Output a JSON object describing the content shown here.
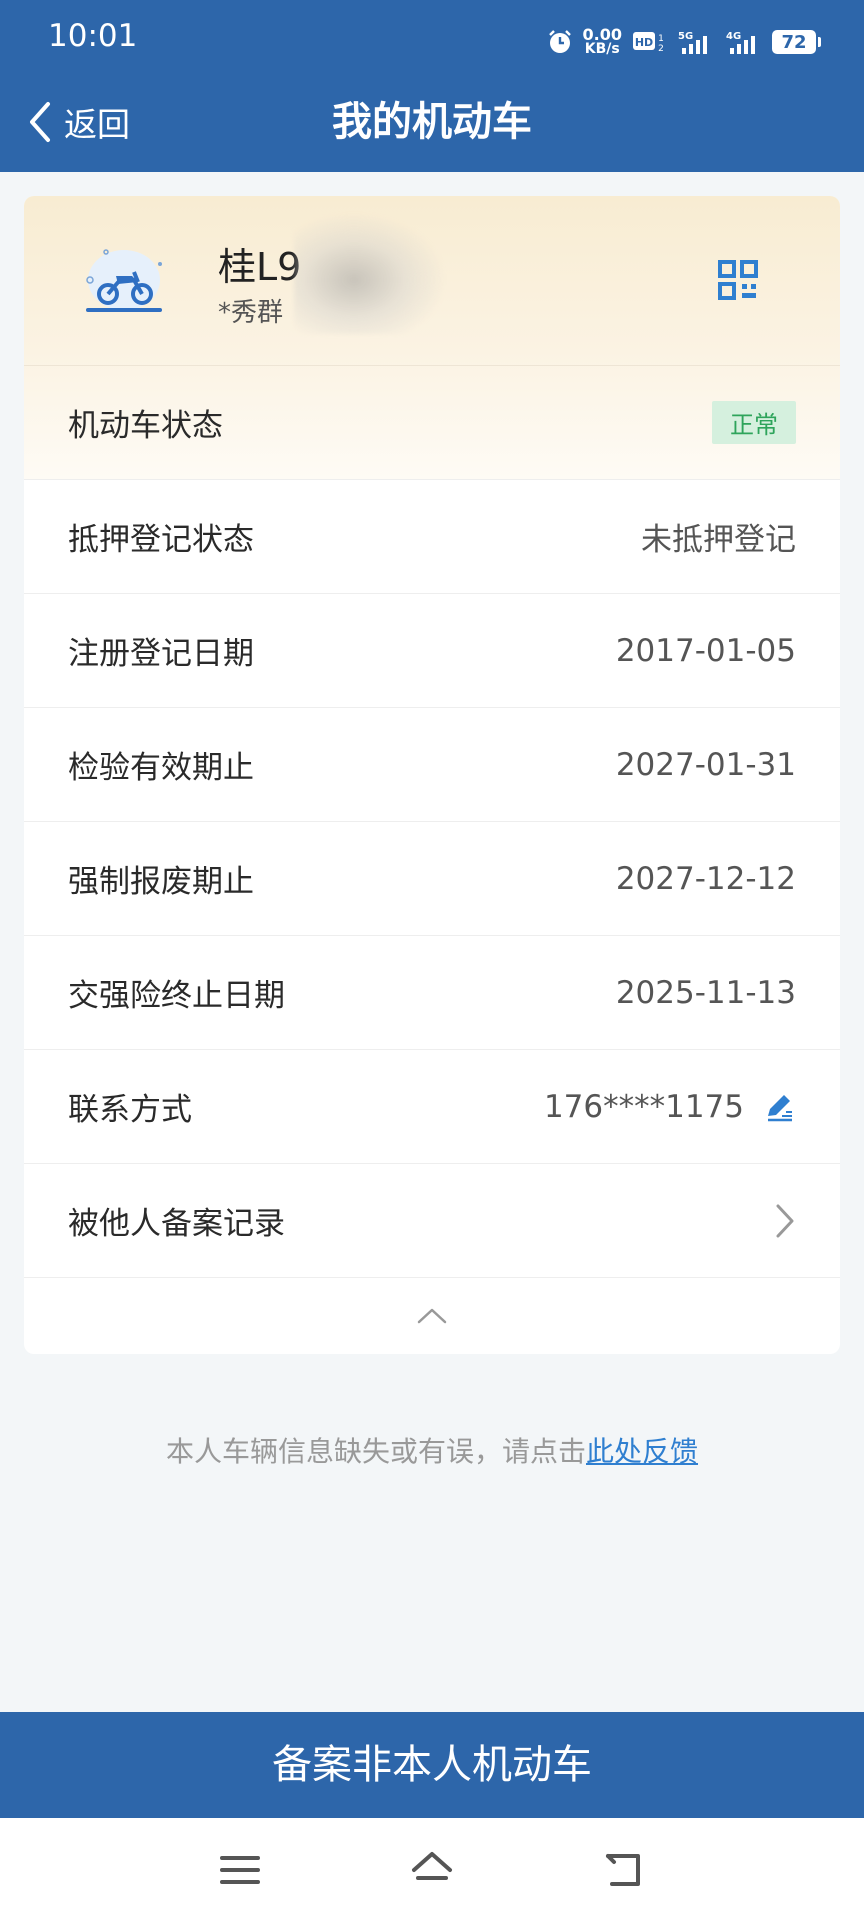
{
  "status_bar": {
    "time": "10:01",
    "net_speed_value": "0.00",
    "net_speed_unit": "KB/s",
    "battery": "72",
    "icons": [
      "alarm-icon",
      "hd-icon",
      "signal-5g-icon",
      "signal-4g-icon",
      "battery-icon"
    ]
  },
  "nav": {
    "back_label": "返回",
    "title": "我的机动车"
  },
  "vehicle": {
    "plate": "桂L9",
    "owner": "*秀群",
    "icon": "motorcycle-icon",
    "qr_icon": "qr-code-icon"
  },
  "details": {
    "status_label": "机动车状态",
    "status_value": "正常",
    "mortgage_label": "抵押登记状态",
    "mortgage_value": "未抵押登记",
    "register_label": "注册登记日期",
    "register_value": "2017-01-05",
    "inspection_label": "检验有效期止",
    "inspection_value": "2027-01-31",
    "scrap_label": "强制报废期止",
    "scrap_value": "2027-12-12",
    "insurance_label": "交强险终止日期",
    "insurance_value": "2025-11-13",
    "contact_label": "联系方式",
    "contact_value": "176****1175",
    "filing_label": "被他人备案记录"
  },
  "feedback": {
    "text": "本人车辆信息缺失或有误，请点击",
    "link": "此处反馈"
  },
  "bottom_button": "备案非本人机动车",
  "colors": {
    "primary": "#2d66aa",
    "badge_bg": "#d5f0de",
    "badge_text": "#2ea45b",
    "link": "#2f7fd0",
    "icon_blue": "#2f7fd0"
  }
}
